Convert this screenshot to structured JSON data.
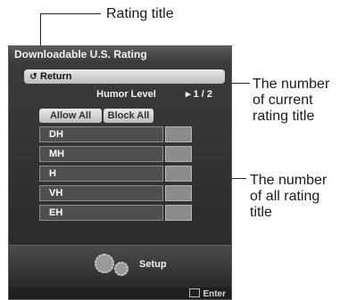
{
  "annotations": {
    "rating_title": "Rating title",
    "current_number_lines": [
      "The number",
      "of current",
      "rating title"
    ],
    "all_number_lines": [
      "The number",
      "of all rating",
      "title"
    ]
  },
  "panel": {
    "title": "Downloadable U.S. Rating",
    "return_label": "Return",
    "return_icon": "return-arrow-icon",
    "rating_title": "Humor Level",
    "counter_arrow": "▸",
    "counter": "1 / 2",
    "buttons": {
      "allow_all": "Allow All",
      "block_all": "Block All"
    },
    "ratings": [
      "DH",
      "MH",
      "H",
      "VH",
      "EH"
    ],
    "setup_label": "Setup",
    "enter_label": "Enter"
  },
  "colors": {
    "panel_bg": "#2f2f2f",
    "highlight_bar": "#d6d6d6",
    "rating_box": "#8c8c8c"
  }
}
